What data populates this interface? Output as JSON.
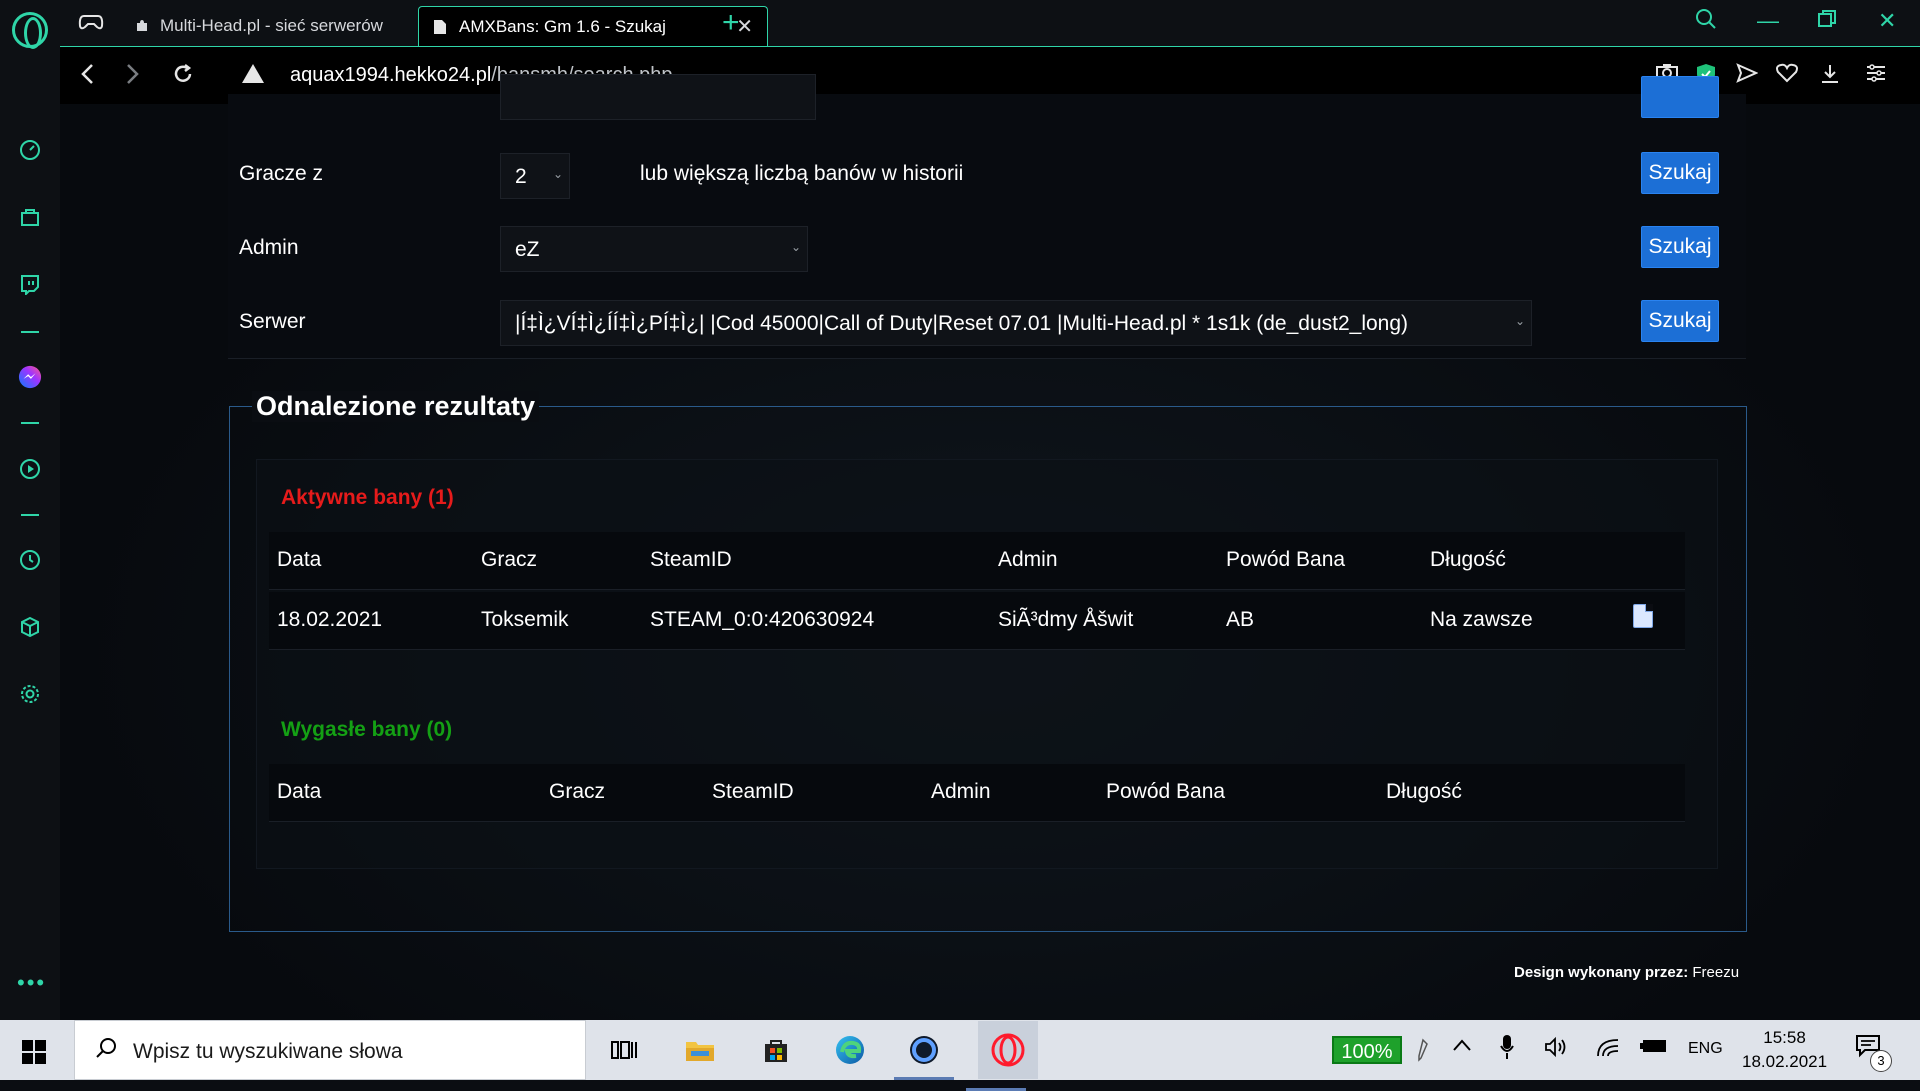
{
  "browser": {
    "tabs": [
      {
        "title": "Multi-Head.pl - sieć serwerów"
      },
      {
        "title": "AMXBans: Gm 1.6 - Szukaj"
      }
    ],
    "url_domain": "aquax1994.hekko24.pl",
    "url_path": "/bansmh/search.php"
  },
  "search_form": {
    "gracze_label": "Gracze z",
    "gracze_value": "2",
    "gracze_hint": "lub większą liczbą banów w historii",
    "admin_label": "Admin",
    "admin_value": "eZ",
    "serwer_label": "Serwer",
    "serwer_value": "|Í‡Ì¿VÍ‡Ì¿ÍÍ‡Ì¿PÍ‡Ì¿| |Cod 45000|Call of Duty|Reset 07.01 |Multi-Head.pl * 1s1k (de_dust2_long)",
    "search_button": "Szukaj"
  },
  "results": {
    "legend": "Odnalezione rezultaty",
    "active_title": "Aktywne bany (1)",
    "expired_title": "Wygasłe bany (0)",
    "columns": [
      "Data",
      "Gracz",
      "SteamID",
      "Admin",
      "Powód Bana",
      "Długość"
    ],
    "active_rows": [
      {
        "date": "18.02.2021",
        "player": "Toksemik",
        "steamid": "STEAM_0:0:420630924",
        "admin": "SiÃ³dmy Åšwit",
        "reason": "AB",
        "length": "Na zawsze"
      }
    ]
  },
  "footer": {
    "label": "Design wykonany przez:",
    "author": "Freezu"
  },
  "taskbar": {
    "search_placeholder": "Wpisz tu wyszukiwane słowa",
    "battery": "100%",
    "language": "ENG",
    "time": "15:58",
    "date": "18.02.2021",
    "notifications": "3"
  }
}
